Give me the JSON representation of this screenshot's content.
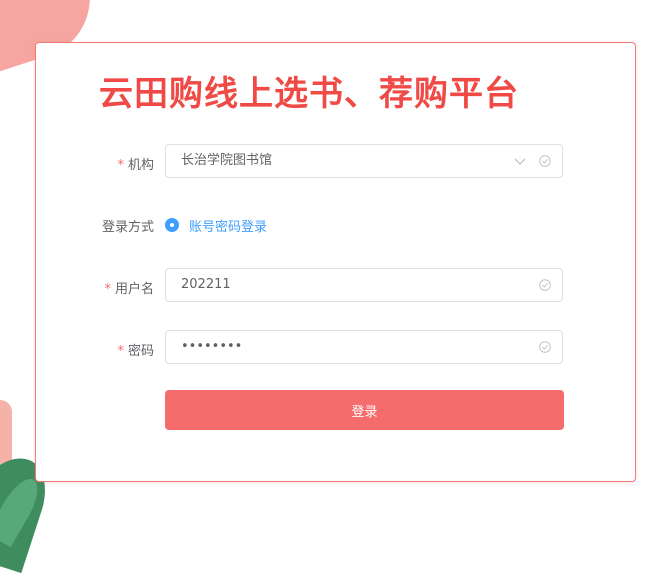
{
  "colors": {
    "accent": "#f56c6c",
    "title": "#ef4a45",
    "radio": "#409eff",
    "border": "#f07b76"
  },
  "title": "云田购线上选书、荐购平台",
  "form": {
    "required_mark": "*",
    "institution": {
      "label": "机构",
      "value": "长治学院图书馆",
      "icons": [
        "chevron-down-icon",
        "check-circle-icon"
      ]
    },
    "login_method": {
      "label": "登录方式",
      "option": "账号密码登录",
      "selected": true
    },
    "username": {
      "label": "用户名",
      "value": "202211",
      "icon": "check-circle-icon"
    },
    "password": {
      "label": "密码",
      "value": "••••••••",
      "icon": "check-circle-icon"
    },
    "submit_label": "登录"
  }
}
